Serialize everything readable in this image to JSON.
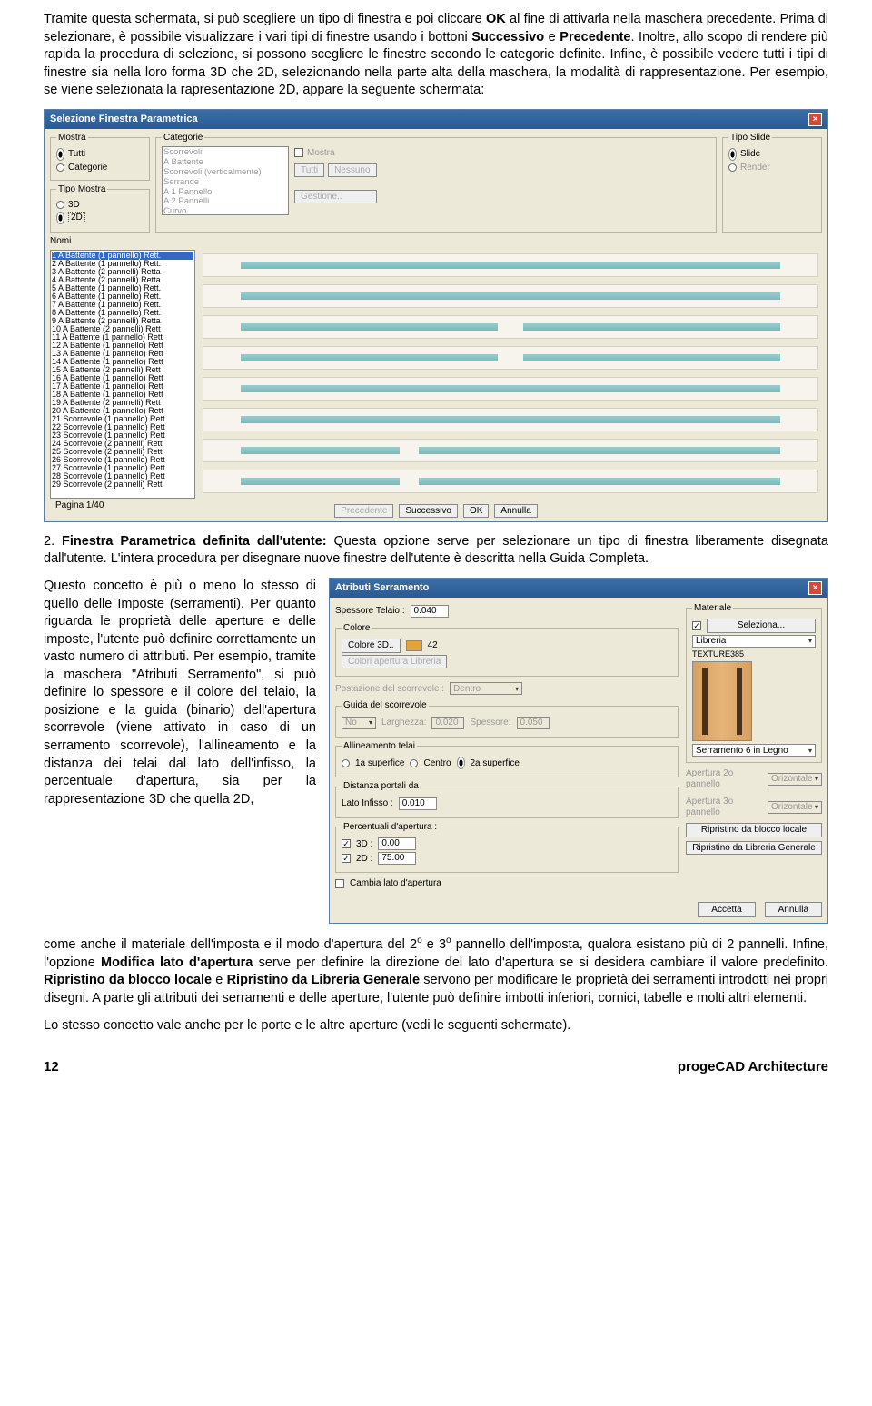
{
  "para1_a": "Tramite questa schermata, si può scegliere un tipo di finestra e poi cliccare ",
  "para1_b": "OK",
  "para1_c": " al fine di attivarla nella maschera precedente. Prima di selezionare, è possibile visualizzare i vari tipi di finestre usando i bottoni ",
  "para1_d": "Successivo",
  "para1_e": " e ",
  "para1_f": "Precedente",
  "para1_g": ". Inoltre, allo scopo di rendere più rapida la procedura di selezione, si possono scegliere le finestre secondo le categorie definite. Infine, è possibile vedere tutti i tipi di finestre sia nella loro forma 3D che 2D, selezionando nella parte alta della maschera, la modalità di rappresentazione. Per esempio, se viene selezionata la rapresentazione 2D, appare la seguente schermata:",
  "dlg1": {
    "title": "Selezione Finestra Parametrica",
    "mostra": {
      "legend": "Mostra",
      "tutti": "Tutti",
      "categorie": "Categorie"
    },
    "tipoMostra": {
      "legend": "Tipo Mostra",
      "r3d": "3D",
      "r2d": "2D"
    },
    "categorie": {
      "legend": "Categorie",
      "items": [
        "Scorrevoli",
        "A Battente",
        "Scorrevoli (verticalmente)",
        "Serrande",
        "A 1 Pannello",
        "A 2 Pannelli",
        "Curvo"
      ],
      "mostra": "Mostra",
      "tutti": "Tutti",
      "nessuno": "Nessuno",
      "gestione": "Gestione.."
    },
    "tipoSlide": {
      "legend": "Tipo Slide",
      "slide": "Slide",
      "render": "Render"
    },
    "nomiLbl": "Nomi",
    "nomi": [
      "1 A Battente (1 pannello) Rett.",
      "2 A Battente (1 pannello) Rett.",
      "3 A Battente (2 pannelli) Retta",
      "4 A Battente (2 pannelli) Retta",
      "5 A Battente (1 pannello) Rett.",
      "6 A Battente (1 pannello) Rett.",
      "7 A Battente (1 pannello) Rett.",
      "8 A Battente (1 pannello) Rett.",
      "9 A Battente (2 pannelli) Retta",
      "10 A Battente (2 pannelli) Rett",
      "11 A Battente (1 pannello) Rett",
      "12 A Battente (1 pannello) Rett",
      "13 A Battente (1 pannello) Rett",
      "14 A Battente (1 pannello) Rett",
      "15 A Battente (2 pannelli) Rett",
      "16 A Battente (1 pannello) Rett",
      "17 A Battente (1 pannello) Rett",
      "18 A Battente (1 pannello) Rett",
      "19 A Battente (2 pannelli) Rett",
      "20 A Battente (1 pannello) Rett",
      "21 Scorrevole (1 pannello) Rett",
      "22 Scorrevole (1 pannello) Rett",
      "23 Scorrevole (1 pannello) Rett",
      "24 Scorrevole (2 pannelli) Rett",
      "25 Scorrevole (2 pannelli) Rett",
      "26 Scorrevole (1 pannello) Rett",
      "27 Scorrevole (1 pannello) Rett",
      "28 Scorrevole (1 pannello) Rett",
      "29 Scorrevole (2 pannelli) Rett"
    ],
    "page": "Pagina 1/40",
    "prec": "Precedente",
    "succ": "Successivo",
    "ok": "OK",
    "ann": "Annulla"
  },
  "para2_a": "2. ",
  "para2_b": "Finestra Parametrica definita dall'utente:",
  "para2_c": " Questa opzione serve per selezionare un tipo di finestra liberamente disegnata dall'utente. L'intera procedura per disegnare nuove finestre dell'utente è descritta nella Guida Completa.",
  "para3": "Questo concetto è più o meno lo stesso di quello delle Imposte (serramenti). Per quanto riguarda le proprietà delle aperture e delle imposte, l'utente può definire correttamente un vasto numero di attributi. Per esempio, tramite la maschera \"Atributi Serramento\", si può definire lo spessore e il colore del telaio, la posizione e la guida (binario) dell'apertura scorrevole (viene attivato in caso di un serramento scorrevole), l'allineamento e la distanza dei telai dal lato dell'infisso, la percentuale d'apertura, sia per la rappresentazione 3D che quella 2D,",
  "dlg2": {
    "title": "Atributi Serramento",
    "spess": "Spessore Telaio :",
    "spessV": "0.040",
    "colore": "Colore",
    "colore3d": "Colore 3D..",
    "colVal": "42",
    "coloriAL": "Colori apertura Libreria",
    "postaz": "Postazione del scorrevole :",
    "postazV": "Dentro",
    "guida": "Guida del scorrevole",
    "guidaOpt": "No",
    "largh": "Larghezza:",
    "larghV": "0.020",
    "spessG": "Spessore:",
    "spessGV": "0.050",
    "allin": "Allineamento telai",
    "a1": "1a superfice",
    "ac": "Centro",
    "a2": "2a superfice",
    "dist": "Distanza portali da",
    "lato": "Lato Infisso :",
    "latoV": "0.010",
    "perc": "Percentuali d'apertura :",
    "p3d": "3D :",
    "p3dV": "0.00",
    "p2d": "2D :",
    "p2dV": "75.00",
    "cambia": "Cambia lato d'apertura",
    "materiale": "Materiale",
    "selez": "Seleziona...",
    "lib": "Libreria",
    "texname": "TEXTURE385",
    "serr6": "Serramento 6 in Legno",
    "ap2": "Apertura 2o pannello",
    "ap3": "Apertura 3o pannello",
    "oriz": "Orizontale",
    "ripLoc": "Ripristino da blocco locale",
    "ripGen": "Ripristino da Libreria Generale",
    "accetta": "Accetta",
    "annulla": "Annulla"
  },
  "para4_a": "come anche il materiale dell'imposta e il modo d'apertura del 2",
  "para4_b": " e 3",
  "para4_c": " pannello dell'imposta, qualora esistano più di 2 pannelli. Infine, l'opzione ",
  "para4_d": "Modifica lato d'apertura",
  "para4_e": " serve per definire la direzione del lato d'apertura se si desidera cambiare il valore predefinito. ",
  "para4_f": "Ripristino da blocco locale",
  "para4_g": " e ",
  "para4_h": "Ripristino da Libreria Generale",
  "para4_i": " servono per modificare le proprietà dei serramenti introdotti nei propri disegni. A parte gli attributi dei serramenti e delle aperture, l'utente può definire imbotti inferiori, cornici, tabelle e molti altri elementi.",
  "para5": "Lo stesso concetto vale anche per le porte e le altre aperture (vedi le seguenti schermate).",
  "foot_l": "12",
  "foot_r": "progeCAD Architecture",
  "sup": "o"
}
